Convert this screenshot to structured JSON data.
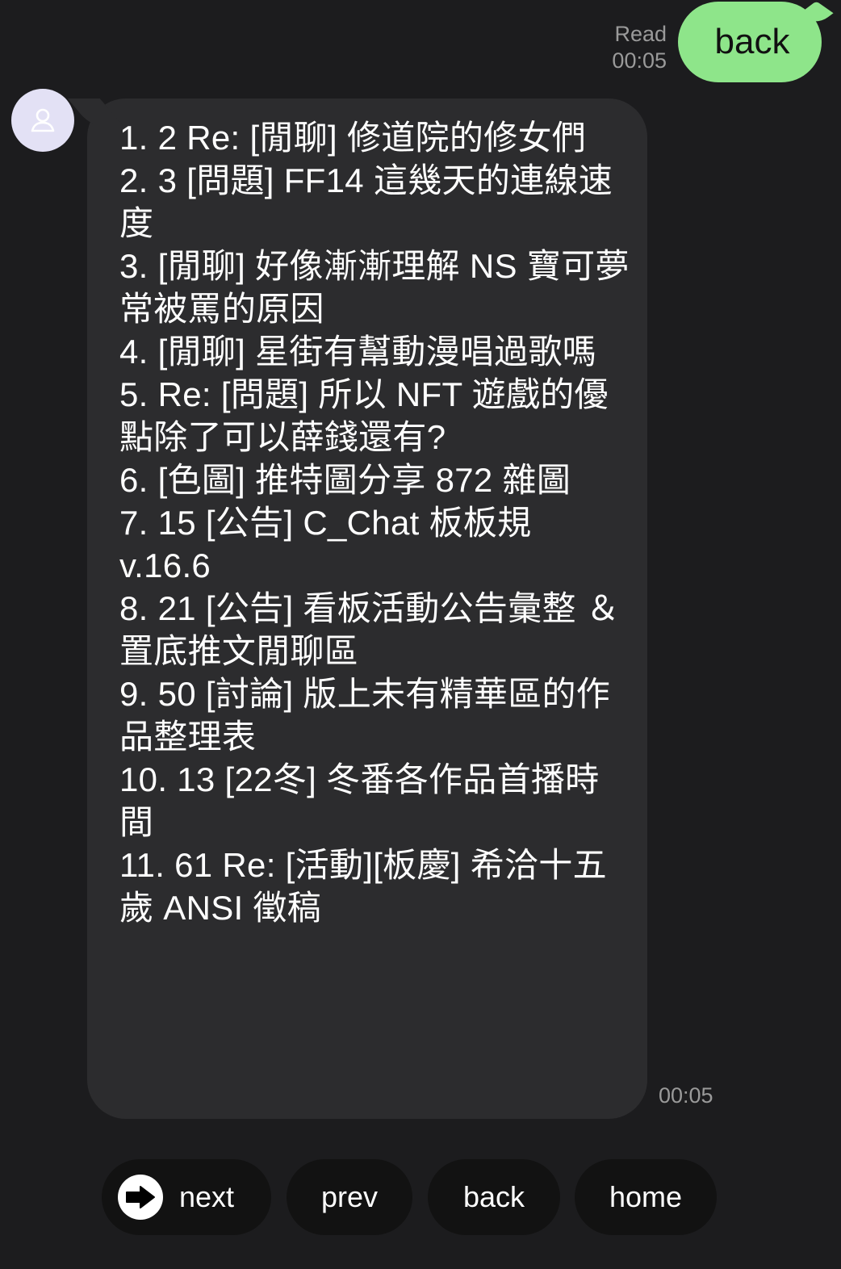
{
  "outgoing": {
    "read_label": "Read",
    "time": "00:05",
    "text": "back"
  },
  "incoming": {
    "avatar_icon": "person-icon",
    "time": "00:05",
    "lines": [
      " 1.   2 Re: [閒聊] 修道院的修女們",
      " 2.   3 [問題] FF14 這幾天的連線速度",
      " 3.     [閒聊] 好像漸漸理解 NS 寶可夢常被罵的原因",
      " 4.     [閒聊] 星街有幫動漫唱過歌嗎",
      " 5.     Re: [問題] 所以 NFT 遊戲的優點除了可以薛錢還有?",
      " 6.     [色圖] 推特圖分享 872 雜圖",
      " 7.  15 [公告] C_Chat 板板規 v.16.6",
      " 8.  21 [公告] 看板活動公告彙整 ＆ 置底推文閒聊區",
      " 9.  50 [討論] 版上未有精華區的作品整理表",
      "10.  13 [22冬] 冬番各作品首播時間",
      "11.  61 Re: [活動][板慶] 希洽十五歲 ANSI 徵稿"
    ]
  },
  "quick_replies": {
    "next_icon": "arrow-right-icon",
    "next": "next",
    "prev": "prev",
    "back": "back",
    "home": "home"
  },
  "colors": {
    "background": "#1c1c1e",
    "incoming_bubble": "#2c2c2e",
    "outgoing_bubble": "#8ee58a",
    "avatar_bg": "#e3e1f5",
    "quick_reply_bg": "#121212",
    "meta_text": "#9a9a9a"
  }
}
